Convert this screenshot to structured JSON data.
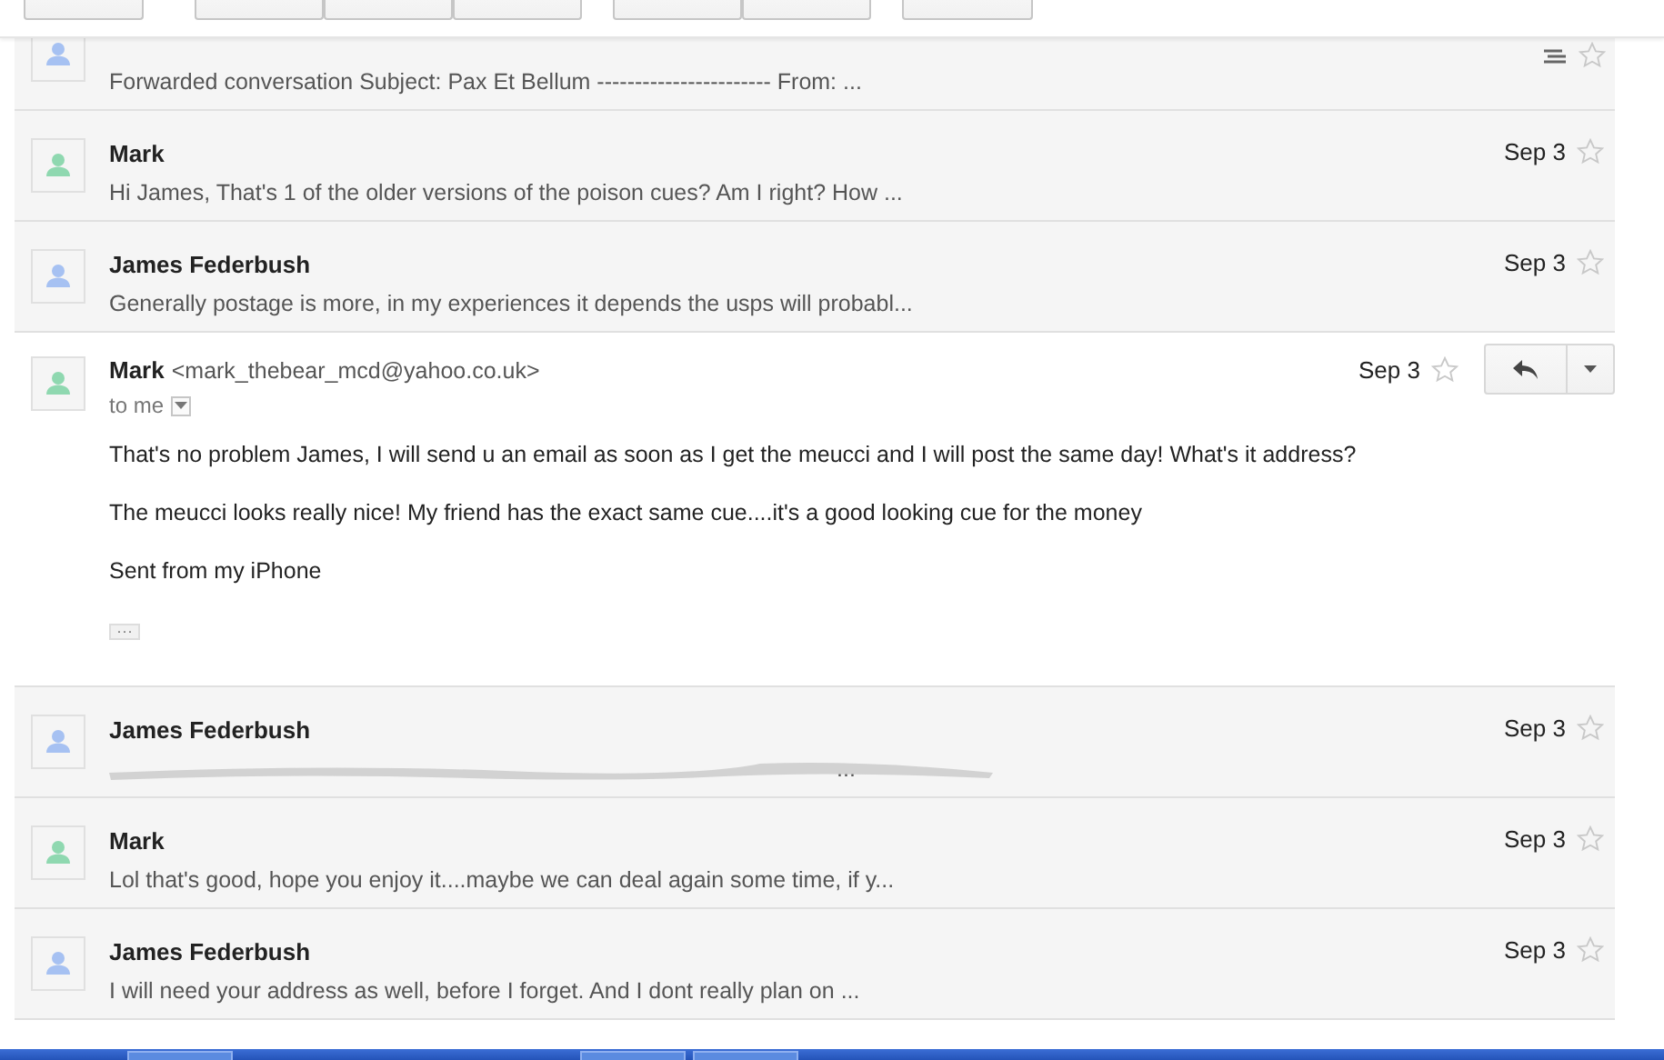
{
  "toolbar": {
    "buttons": [
      {
        "kind": "single"
      },
      {
        "kind": "group3"
      },
      {
        "kind": "group2"
      },
      {
        "kind": "single"
      }
    ]
  },
  "messages": [
    {
      "kind": "collapsed",
      "color": "#a6c1f2",
      "starred": false,
      "forwarded": true,
      "snippet": "Forwarded conversation Subject: Pax Et Bellum ----------------------- From: ...",
      "redacted": false
    },
    {
      "kind": "collapsed",
      "sender": "Mark",
      "color": "#8fd8b0",
      "date": "Sep 3",
      "starred": false,
      "forwarded": false,
      "snippet": "Hi James, That's 1 of the older versions of the poison cues? Am I right? How ...",
      "redacted": false
    },
    {
      "kind": "collapsed",
      "sender": "James Federbush",
      "color": "#a6c1f2",
      "date": "Sep 3",
      "starred": false,
      "forwarded": false,
      "snippet": "Generally postage is more, in my experiences it depends the usps will probabl...",
      "redacted": false
    },
    {
      "kind": "expanded",
      "sender": "Mark",
      "email": "<mark_thebear_mcd@yahoo.co.uk>",
      "color": "#8fd8b0",
      "date": "Sep 3",
      "starred": false,
      "recipient": "to me",
      "body": [
        "That's no problem James, I will send u an email as soon as I get the meucci and I will post the same day! What's it address?",
        "The meucci looks really nice! My friend has the exact same cue....it's a good looking cue for the money",
        "Sent from my iPhone"
      ],
      "trimmed": "···"
    },
    {
      "kind": "collapsed",
      "sender": "James Federbush",
      "color": "#a6c1f2",
      "date": "Sep 3",
      "starred": false,
      "forwarded": false,
      "snippet": "...",
      "redacted": true
    },
    {
      "kind": "collapsed",
      "sender": "Mark",
      "color": "#8fd8b0",
      "date": "Sep 3",
      "starred": false,
      "forwarded": false,
      "snippet": "Lol that's good, hope you enjoy it....maybe we can deal again some time, if y...",
      "redacted": false
    },
    {
      "kind": "collapsed",
      "sender": "James Federbush",
      "color": "#a6c1f2",
      "date": "Sep 3",
      "starred": false,
      "forwarded": false,
      "snippet": "I will need your address as well, before I forget. And I dont really plan on ...",
      "redacted": false
    }
  ]
}
